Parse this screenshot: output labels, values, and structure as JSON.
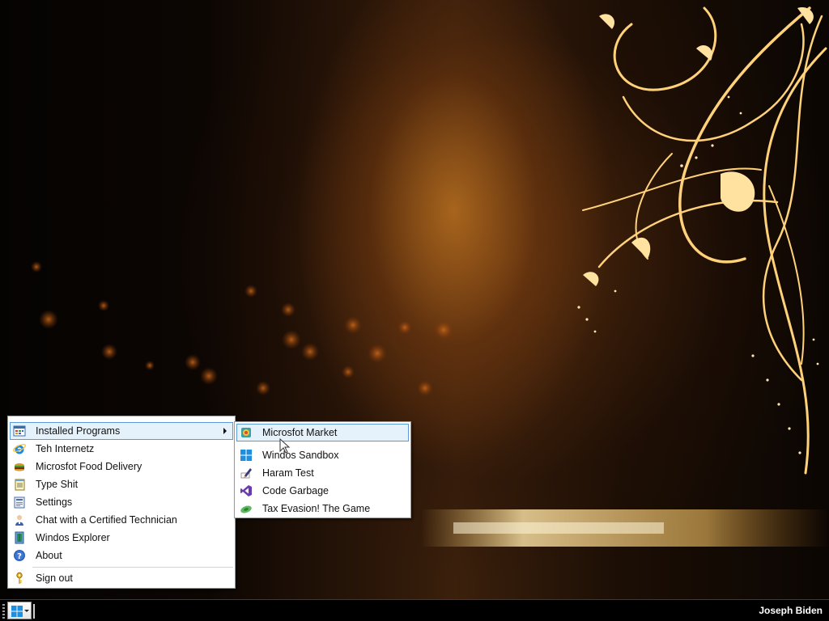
{
  "start_menu": {
    "items": [
      {
        "label": "Installed Programs",
        "icon": "programs-icon",
        "has_submenu": true
      },
      {
        "label": "Teh Internetz",
        "icon": "internet-explorer-icon"
      },
      {
        "label": "Microsfot Food Delivery",
        "icon": "burger-icon"
      },
      {
        "label": "Type Shit",
        "icon": "notepad-icon"
      },
      {
        "label": "Settings",
        "icon": "settings-icon"
      },
      {
        "label": "Chat with a Certified Technician",
        "icon": "technician-icon"
      },
      {
        "label": "Windos Explorer",
        "icon": "explorer-icon"
      },
      {
        "label": "About",
        "icon": "help-icon"
      }
    ],
    "sign_out_label": "Sign out",
    "sign_out_icon": "key-icon"
  },
  "programs_submenu": {
    "items": [
      {
        "label": "Microsfot Market",
        "icon": "market-icon"
      },
      {
        "label": "Windos Sandbox",
        "icon": "windows-logo-icon"
      },
      {
        "label": "Haram Test",
        "icon": "pen-icon"
      },
      {
        "label": "Code Garbage",
        "icon": "visual-studio-icon"
      },
      {
        "label": "Tax Evasion! The Game",
        "icon": "game-icon"
      }
    ]
  },
  "taskbar": {
    "user_name": "Joseph Biden",
    "start_icon": "windows-logo-icon"
  },
  "colors": {
    "hover_border": "#5a9ad8",
    "hover_fill": "#e6f2fb",
    "taskbar": "#000000",
    "windows_blue": "#1d8fe0"
  }
}
